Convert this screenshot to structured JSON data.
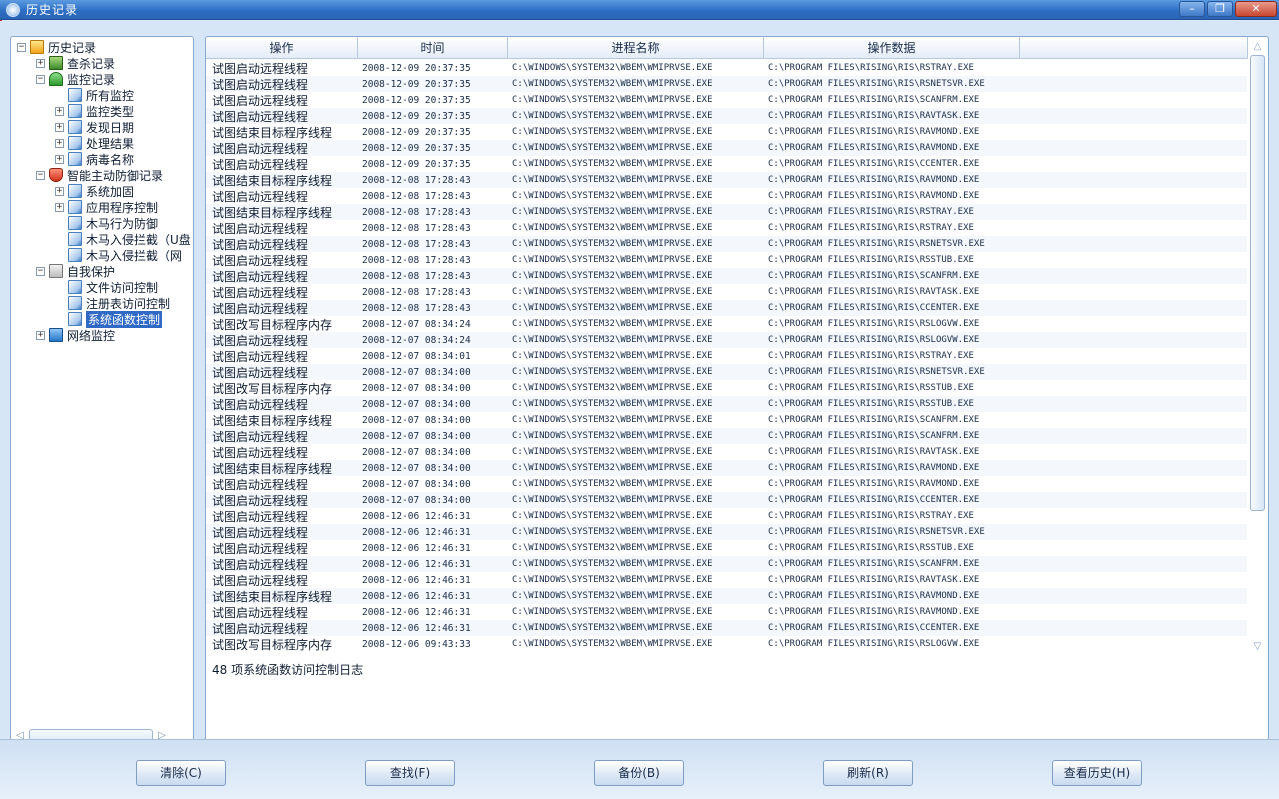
{
  "window": {
    "title": "历史记录",
    "buttons": [
      "–",
      "❐",
      "✕"
    ]
  },
  "tree": {
    "items": [
      {
        "label": "历史记录",
        "level": 0,
        "expander": "−",
        "icon": "folder",
        "selected": false
      },
      {
        "label": "查杀记录",
        "level": 1,
        "expander": "+",
        "icon": "kill",
        "selected": false
      },
      {
        "label": "监控记录",
        "level": 1,
        "expander": "−",
        "icon": "umbrella",
        "selected": false
      },
      {
        "label": "所有监控",
        "level": 2,
        "expander": "",
        "icon": "doc",
        "selected": false
      },
      {
        "label": "监控类型",
        "level": 2,
        "expander": "+",
        "icon": "doc",
        "selected": false
      },
      {
        "label": "发现日期",
        "level": 2,
        "expander": "+",
        "icon": "doc",
        "selected": false
      },
      {
        "label": "处理结果",
        "level": 2,
        "expander": "+",
        "icon": "doc",
        "selected": false
      },
      {
        "label": "病毒名称",
        "level": 2,
        "expander": "+",
        "icon": "doc",
        "selected": false
      },
      {
        "label": "智能主动防御记录",
        "level": 1,
        "expander": "−",
        "icon": "shield",
        "selected": false
      },
      {
        "label": "系统加固",
        "level": 2,
        "expander": "+",
        "icon": "doc",
        "selected": false
      },
      {
        "label": "应用程序控制",
        "level": 2,
        "expander": "+",
        "icon": "doc",
        "selected": false
      },
      {
        "label": "木马行为防御",
        "level": 2,
        "expander": "",
        "icon": "doc",
        "selected": false
      },
      {
        "label": "木马入侵拦截（U盘",
        "level": 2,
        "expander": "",
        "icon": "doc",
        "selected": false
      },
      {
        "label": "木马入侵拦截（网",
        "level": 2,
        "expander": "",
        "icon": "doc",
        "selected": false
      },
      {
        "label": "自我保护",
        "level": 1,
        "expander": "−",
        "icon": "lock",
        "selected": false
      },
      {
        "label": "文件访问控制",
        "level": 2,
        "expander": "",
        "icon": "doc",
        "selected": false
      },
      {
        "label": "注册表访问控制",
        "level": 2,
        "expander": "",
        "icon": "doc",
        "selected": false
      },
      {
        "label": "系统函数控制",
        "level": 2,
        "expander": "",
        "icon": "doc",
        "selected": true
      },
      {
        "label": "网络监控",
        "level": 1,
        "expander": "+",
        "icon": "net",
        "selected": false
      }
    ]
  },
  "list": {
    "columns": [
      "操作",
      "时间",
      "进程名称",
      "操作数据"
    ],
    "rows": [
      [
        "试图启动远程线程",
        "2008-12-09 20:37:35",
        "C:\\WINDOWS\\SYSTEM32\\WBEM\\WMIPRVSE.EXE",
        "C:\\PROGRAM FILES\\RISING\\RIS\\RSTRAY.EXE"
      ],
      [
        "试图启动远程线程",
        "2008-12-09 20:37:35",
        "C:\\WINDOWS\\SYSTEM32\\WBEM\\WMIPRVSE.EXE",
        "C:\\PROGRAM FILES\\RISING\\RIS\\RSNETSVR.EXE"
      ],
      [
        "试图启动远程线程",
        "2008-12-09 20:37:35",
        "C:\\WINDOWS\\SYSTEM32\\WBEM\\WMIPRVSE.EXE",
        "C:\\PROGRAM FILES\\RISING\\RIS\\SCANFRM.EXE"
      ],
      [
        "试图启动远程线程",
        "2008-12-09 20:37:35",
        "C:\\WINDOWS\\SYSTEM32\\WBEM\\WMIPRVSE.EXE",
        "C:\\PROGRAM FILES\\RISING\\RIS\\RAVTASK.EXE"
      ],
      [
        "试图结束目标程序线程",
        "2008-12-09 20:37:35",
        "C:\\WINDOWS\\SYSTEM32\\WBEM\\WMIPRVSE.EXE",
        "C:\\PROGRAM FILES\\RISING\\RIS\\RAVMOND.EXE"
      ],
      [
        "试图启动远程线程",
        "2008-12-09 20:37:35",
        "C:\\WINDOWS\\SYSTEM32\\WBEM\\WMIPRVSE.EXE",
        "C:\\PROGRAM FILES\\RISING\\RIS\\RAVMOND.EXE"
      ],
      [
        "试图启动远程线程",
        "2008-12-09 20:37:35",
        "C:\\WINDOWS\\SYSTEM32\\WBEM\\WMIPRVSE.EXE",
        "C:\\PROGRAM FILES\\RISING\\RIS\\CCENTER.EXE"
      ],
      [
        "试图结束目标程序线程",
        "2008-12-08 17:28:43",
        "C:\\WINDOWS\\SYSTEM32\\WBEM\\WMIPRVSE.EXE",
        "C:\\PROGRAM FILES\\RISING\\RIS\\RAVMOND.EXE"
      ],
      [
        "试图启动远程线程",
        "2008-12-08 17:28:43",
        "C:\\WINDOWS\\SYSTEM32\\WBEM\\WMIPRVSE.EXE",
        "C:\\PROGRAM FILES\\RISING\\RIS\\RAVMOND.EXE"
      ],
      [
        "试图结束目标程序线程",
        "2008-12-08 17:28:43",
        "C:\\WINDOWS\\SYSTEM32\\WBEM\\WMIPRVSE.EXE",
        "C:\\PROGRAM FILES\\RISING\\RIS\\RSTRAY.EXE"
      ],
      [
        "试图启动远程线程",
        "2008-12-08 17:28:43",
        "C:\\WINDOWS\\SYSTEM32\\WBEM\\WMIPRVSE.EXE",
        "C:\\PROGRAM FILES\\RISING\\RIS\\RSTRAY.EXE"
      ],
      [
        "试图启动远程线程",
        "2008-12-08 17:28:43",
        "C:\\WINDOWS\\SYSTEM32\\WBEM\\WMIPRVSE.EXE",
        "C:\\PROGRAM FILES\\RISING\\RIS\\RSNETSVR.EXE"
      ],
      [
        "试图启动远程线程",
        "2008-12-08 17:28:43",
        "C:\\WINDOWS\\SYSTEM32\\WBEM\\WMIPRVSE.EXE",
        "C:\\PROGRAM FILES\\RISING\\RIS\\RSSTUB.EXE"
      ],
      [
        "试图启动远程线程",
        "2008-12-08 17:28:43",
        "C:\\WINDOWS\\SYSTEM32\\WBEM\\WMIPRVSE.EXE",
        "C:\\PROGRAM FILES\\RISING\\RIS\\SCANFRM.EXE"
      ],
      [
        "试图启动远程线程",
        "2008-12-08 17:28:43",
        "C:\\WINDOWS\\SYSTEM32\\WBEM\\WMIPRVSE.EXE",
        "C:\\PROGRAM FILES\\RISING\\RIS\\RAVTASK.EXE"
      ],
      [
        "试图启动远程线程",
        "2008-12-08 17:28:43",
        "C:\\WINDOWS\\SYSTEM32\\WBEM\\WMIPRVSE.EXE",
        "C:\\PROGRAM FILES\\RISING\\RIS\\CCENTER.EXE"
      ],
      [
        "试图改写目标程序内存",
        "2008-12-07 08:34:24",
        "C:\\WINDOWS\\SYSTEM32\\WBEM\\WMIPRVSE.EXE",
        "C:\\PROGRAM FILES\\RISING\\RIS\\RSLOGVW.EXE"
      ],
      [
        "试图启动远程线程",
        "2008-12-07 08:34:24",
        "C:\\WINDOWS\\SYSTEM32\\WBEM\\WMIPRVSE.EXE",
        "C:\\PROGRAM FILES\\RISING\\RIS\\RSLOGVW.EXE"
      ],
      [
        "试图启动远程线程",
        "2008-12-07 08:34:01",
        "C:\\WINDOWS\\SYSTEM32\\WBEM\\WMIPRVSE.EXE",
        "C:\\PROGRAM FILES\\RISING\\RIS\\RSTRAY.EXE"
      ],
      [
        "试图启动远程线程",
        "2008-12-07 08:34:00",
        "C:\\WINDOWS\\SYSTEM32\\WBEM\\WMIPRVSE.EXE",
        "C:\\PROGRAM FILES\\RISING\\RIS\\RSNETSVR.EXE"
      ],
      [
        "试图改写目标程序内存",
        "2008-12-07 08:34:00",
        "C:\\WINDOWS\\SYSTEM32\\WBEM\\WMIPRVSE.EXE",
        "C:\\PROGRAM FILES\\RISING\\RIS\\RSSTUB.EXE"
      ],
      [
        "试图启动远程线程",
        "2008-12-07 08:34:00",
        "C:\\WINDOWS\\SYSTEM32\\WBEM\\WMIPRVSE.EXE",
        "C:\\PROGRAM FILES\\RISING\\RIS\\RSSTUB.EXE"
      ],
      [
        "试图结束目标程序线程",
        "2008-12-07 08:34:00",
        "C:\\WINDOWS\\SYSTEM32\\WBEM\\WMIPRVSE.EXE",
        "C:\\PROGRAM FILES\\RISING\\RIS\\SCANFRM.EXE"
      ],
      [
        "试图启动远程线程",
        "2008-12-07 08:34:00",
        "C:\\WINDOWS\\SYSTEM32\\WBEM\\WMIPRVSE.EXE",
        "C:\\PROGRAM FILES\\RISING\\RIS\\SCANFRM.EXE"
      ],
      [
        "试图启动远程线程",
        "2008-12-07 08:34:00",
        "C:\\WINDOWS\\SYSTEM32\\WBEM\\WMIPRVSE.EXE",
        "C:\\PROGRAM FILES\\RISING\\RIS\\RAVTASK.EXE"
      ],
      [
        "试图结束目标程序线程",
        "2008-12-07 08:34:00",
        "C:\\WINDOWS\\SYSTEM32\\WBEM\\WMIPRVSE.EXE",
        "C:\\PROGRAM FILES\\RISING\\RIS\\RAVMOND.EXE"
      ],
      [
        "试图启动远程线程",
        "2008-12-07 08:34:00",
        "C:\\WINDOWS\\SYSTEM32\\WBEM\\WMIPRVSE.EXE",
        "C:\\PROGRAM FILES\\RISING\\RIS\\RAVMOND.EXE"
      ],
      [
        "试图启动远程线程",
        "2008-12-07 08:34:00",
        "C:\\WINDOWS\\SYSTEM32\\WBEM\\WMIPRVSE.EXE",
        "C:\\PROGRAM FILES\\RISING\\RIS\\CCENTER.EXE"
      ],
      [
        "试图启动远程线程",
        "2008-12-06 12:46:31",
        "C:\\WINDOWS\\SYSTEM32\\WBEM\\WMIPRVSE.EXE",
        "C:\\PROGRAM FILES\\RISING\\RIS\\RSTRAY.EXE"
      ],
      [
        "试图启动远程线程",
        "2008-12-06 12:46:31",
        "C:\\WINDOWS\\SYSTEM32\\WBEM\\WMIPRVSE.EXE",
        "C:\\PROGRAM FILES\\RISING\\RIS\\RSNETSVR.EXE"
      ],
      [
        "试图启动远程线程",
        "2008-12-06 12:46:31",
        "C:\\WINDOWS\\SYSTEM32\\WBEM\\WMIPRVSE.EXE",
        "C:\\PROGRAM FILES\\RISING\\RIS\\RSSTUB.EXE"
      ],
      [
        "试图启动远程线程",
        "2008-12-06 12:46:31",
        "C:\\WINDOWS\\SYSTEM32\\WBEM\\WMIPRVSE.EXE",
        "C:\\PROGRAM FILES\\RISING\\RIS\\SCANFRM.EXE"
      ],
      [
        "试图启动远程线程",
        "2008-12-06 12:46:31",
        "C:\\WINDOWS\\SYSTEM32\\WBEM\\WMIPRVSE.EXE",
        "C:\\PROGRAM FILES\\RISING\\RIS\\RAVTASK.EXE"
      ],
      [
        "试图结束目标程序线程",
        "2008-12-06 12:46:31",
        "C:\\WINDOWS\\SYSTEM32\\WBEM\\WMIPRVSE.EXE",
        "C:\\PROGRAM FILES\\RISING\\RIS\\RAVMOND.EXE"
      ],
      [
        "试图启动远程线程",
        "2008-12-06 12:46:31",
        "C:\\WINDOWS\\SYSTEM32\\WBEM\\WMIPRVSE.EXE",
        "C:\\PROGRAM FILES\\RISING\\RIS\\RAVMOND.EXE"
      ],
      [
        "试图启动远程线程",
        "2008-12-06 12:46:31",
        "C:\\WINDOWS\\SYSTEM32\\WBEM\\WMIPRVSE.EXE",
        "C:\\PROGRAM FILES\\RISING\\RIS\\CCENTER.EXE"
      ],
      [
        "试图改写目标程序内存",
        "2008-12-06 09:43:33",
        "C:\\WINDOWS\\SYSTEM32\\WBEM\\WMIPRVSE.EXE",
        "C:\\PROGRAM FILES\\RISING\\RIS\\RSLOGVW.EXE"
      ]
    ],
    "status": "48 项系统函数访问控制日志"
  },
  "buttons": {
    "clear": "清除(C)",
    "find": "查找(F)",
    "backup": "备份(B)",
    "refresh": "刷新(R)",
    "history": "查看历史(H)"
  },
  "colors": {
    "accent": "#316ac5",
    "titlebar": "#2f6fc4",
    "background": "#d7e6f6"
  }
}
